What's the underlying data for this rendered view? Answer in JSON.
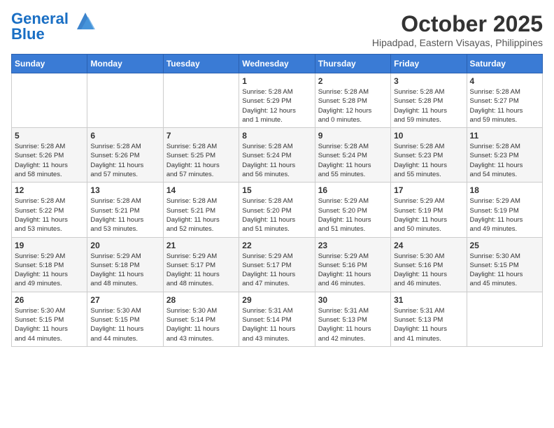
{
  "header": {
    "logo_line1": "General",
    "logo_line2": "Blue",
    "month_year": "October 2025",
    "location": "Hipadpad, Eastern Visayas, Philippines"
  },
  "days_of_week": [
    "Sunday",
    "Monday",
    "Tuesday",
    "Wednesday",
    "Thursday",
    "Friday",
    "Saturday"
  ],
  "weeks": [
    [
      {
        "day": "",
        "info": ""
      },
      {
        "day": "",
        "info": ""
      },
      {
        "day": "",
        "info": ""
      },
      {
        "day": "1",
        "info": "Sunrise: 5:28 AM\nSunset: 5:29 PM\nDaylight: 12 hours\nand 1 minute."
      },
      {
        "day": "2",
        "info": "Sunrise: 5:28 AM\nSunset: 5:28 PM\nDaylight: 12 hours\nand 0 minutes."
      },
      {
        "day": "3",
        "info": "Sunrise: 5:28 AM\nSunset: 5:28 PM\nDaylight: 11 hours\nand 59 minutes."
      },
      {
        "day": "4",
        "info": "Sunrise: 5:28 AM\nSunset: 5:27 PM\nDaylight: 11 hours\nand 59 minutes."
      }
    ],
    [
      {
        "day": "5",
        "info": "Sunrise: 5:28 AM\nSunset: 5:26 PM\nDaylight: 11 hours\nand 58 minutes."
      },
      {
        "day": "6",
        "info": "Sunrise: 5:28 AM\nSunset: 5:26 PM\nDaylight: 11 hours\nand 57 minutes."
      },
      {
        "day": "7",
        "info": "Sunrise: 5:28 AM\nSunset: 5:25 PM\nDaylight: 11 hours\nand 57 minutes."
      },
      {
        "day": "8",
        "info": "Sunrise: 5:28 AM\nSunset: 5:24 PM\nDaylight: 11 hours\nand 56 minutes."
      },
      {
        "day": "9",
        "info": "Sunrise: 5:28 AM\nSunset: 5:24 PM\nDaylight: 11 hours\nand 55 minutes."
      },
      {
        "day": "10",
        "info": "Sunrise: 5:28 AM\nSunset: 5:23 PM\nDaylight: 11 hours\nand 55 minutes."
      },
      {
        "day": "11",
        "info": "Sunrise: 5:28 AM\nSunset: 5:23 PM\nDaylight: 11 hours\nand 54 minutes."
      }
    ],
    [
      {
        "day": "12",
        "info": "Sunrise: 5:28 AM\nSunset: 5:22 PM\nDaylight: 11 hours\nand 53 minutes."
      },
      {
        "day": "13",
        "info": "Sunrise: 5:28 AM\nSunset: 5:21 PM\nDaylight: 11 hours\nand 53 minutes."
      },
      {
        "day": "14",
        "info": "Sunrise: 5:28 AM\nSunset: 5:21 PM\nDaylight: 11 hours\nand 52 minutes."
      },
      {
        "day": "15",
        "info": "Sunrise: 5:28 AM\nSunset: 5:20 PM\nDaylight: 11 hours\nand 51 minutes."
      },
      {
        "day": "16",
        "info": "Sunrise: 5:29 AM\nSunset: 5:20 PM\nDaylight: 11 hours\nand 51 minutes."
      },
      {
        "day": "17",
        "info": "Sunrise: 5:29 AM\nSunset: 5:19 PM\nDaylight: 11 hours\nand 50 minutes."
      },
      {
        "day": "18",
        "info": "Sunrise: 5:29 AM\nSunset: 5:19 PM\nDaylight: 11 hours\nand 49 minutes."
      }
    ],
    [
      {
        "day": "19",
        "info": "Sunrise: 5:29 AM\nSunset: 5:18 PM\nDaylight: 11 hours\nand 49 minutes."
      },
      {
        "day": "20",
        "info": "Sunrise: 5:29 AM\nSunset: 5:18 PM\nDaylight: 11 hours\nand 48 minutes."
      },
      {
        "day": "21",
        "info": "Sunrise: 5:29 AM\nSunset: 5:17 PM\nDaylight: 11 hours\nand 48 minutes."
      },
      {
        "day": "22",
        "info": "Sunrise: 5:29 AM\nSunset: 5:17 PM\nDaylight: 11 hours\nand 47 minutes."
      },
      {
        "day": "23",
        "info": "Sunrise: 5:29 AM\nSunset: 5:16 PM\nDaylight: 11 hours\nand 46 minutes."
      },
      {
        "day": "24",
        "info": "Sunrise: 5:30 AM\nSunset: 5:16 PM\nDaylight: 11 hours\nand 46 minutes."
      },
      {
        "day": "25",
        "info": "Sunrise: 5:30 AM\nSunset: 5:15 PM\nDaylight: 11 hours\nand 45 minutes."
      }
    ],
    [
      {
        "day": "26",
        "info": "Sunrise: 5:30 AM\nSunset: 5:15 PM\nDaylight: 11 hours\nand 44 minutes."
      },
      {
        "day": "27",
        "info": "Sunrise: 5:30 AM\nSunset: 5:15 PM\nDaylight: 11 hours\nand 44 minutes."
      },
      {
        "day": "28",
        "info": "Sunrise: 5:30 AM\nSunset: 5:14 PM\nDaylight: 11 hours\nand 43 minutes."
      },
      {
        "day": "29",
        "info": "Sunrise: 5:31 AM\nSunset: 5:14 PM\nDaylight: 11 hours\nand 43 minutes."
      },
      {
        "day": "30",
        "info": "Sunrise: 5:31 AM\nSunset: 5:13 PM\nDaylight: 11 hours\nand 42 minutes."
      },
      {
        "day": "31",
        "info": "Sunrise: 5:31 AM\nSunset: 5:13 PM\nDaylight: 11 hours\nand 41 minutes."
      },
      {
        "day": "",
        "info": ""
      }
    ]
  ]
}
